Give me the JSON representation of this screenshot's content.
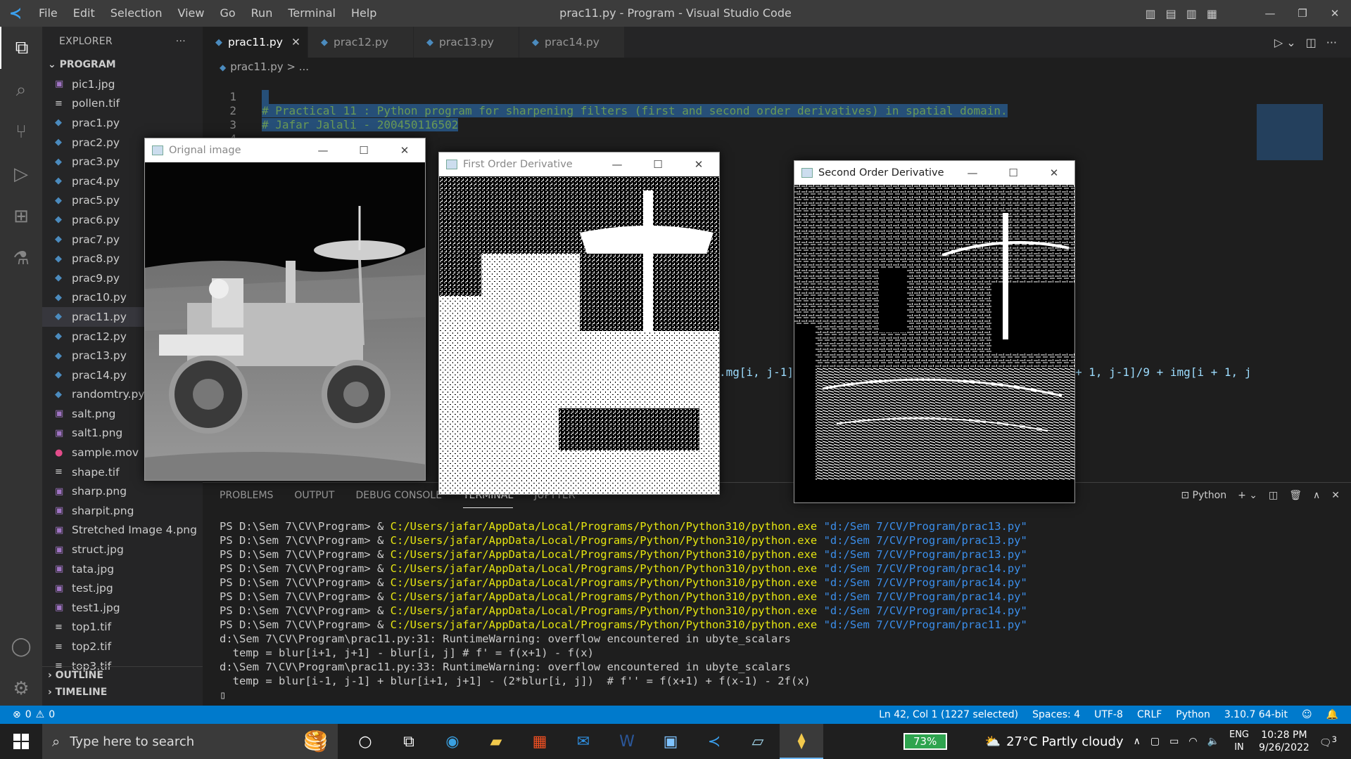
{
  "window": {
    "title": "prac11.py - Program - Visual Studio Code",
    "menu": [
      "File",
      "Edit",
      "Selection",
      "View",
      "Go",
      "Run",
      "Terminal",
      "Help"
    ]
  },
  "explorer": {
    "header": "EXPLORER",
    "more": "···",
    "section": "PROGRAM",
    "files": [
      {
        "name": "pic1.jpg",
        "icon": "image-icon"
      },
      {
        "name": "pollen.tif",
        "icon": "text-file-icon"
      },
      {
        "name": "prac1.py",
        "icon": "python-icon"
      },
      {
        "name": "prac2.py",
        "icon": "python-icon"
      },
      {
        "name": "prac3.py",
        "icon": "python-icon"
      },
      {
        "name": "prac4.py",
        "icon": "python-icon"
      },
      {
        "name": "prac5.py",
        "icon": "python-icon"
      },
      {
        "name": "prac6.py",
        "icon": "python-icon"
      },
      {
        "name": "prac7.py",
        "icon": "python-icon"
      },
      {
        "name": "prac8.py",
        "icon": "python-icon"
      },
      {
        "name": "prac9.py",
        "icon": "python-icon"
      },
      {
        "name": "prac10.py",
        "icon": "python-icon"
      },
      {
        "name": "prac11.py",
        "icon": "python-icon",
        "selected": true
      },
      {
        "name": "prac12.py",
        "icon": "python-icon"
      },
      {
        "name": "prac13.py",
        "icon": "python-icon"
      },
      {
        "name": "prac14.py",
        "icon": "python-icon"
      },
      {
        "name": "randomtry.py",
        "icon": "python-icon"
      },
      {
        "name": "salt.png",
        "icon": "image-icon"
      },
      {
        "name": "salt1.png",
        "icon": "image-icon"
      },
      {
        "name": "sample.mov",
        "icon": "video-icon"
      },
      {
        "name": "shape.tif",
        "icon": "text-file-icon"
      },
      {
        "name": "sharp.png",
        "icon": "image-icon"
      },
      {
        "name": "sharpit.png",
        "icon": "image-icon"
      },
      {
        "name": "Stretched Image 4.png",
        "icon": "image-icon"
      },
      {
        "name": "struct.jpg",
        "icon": "image-icon"
      },
      {
        "name": "tata.jpg",
        "icon": "image-icon"
      },
      {
        "name": "test.jpg",
        "icon": "image-icon"
      },
      {
        "name": "test1.jpg",
        "icon": "image-icon"
      },
      {
        "name": "top1.tif",
        "icon": "text-file-icon"
      },
      {
        "name": "top2.tif",
        "icon": "text-file-icon"
      },
      {
        "name": "top3.tif",
        "icon": "text-file-icon"
      }
    ],
    "outline": "OUTLINE",
    "timeline": "TIMELINE"
  },
  "tabs": [
    {
      "label": "prac11.py",
      "active": true
    },
    {
      "label": "prac12.py"
    },
    {
      "label": "prac13.py"
    },
    {
      "label": "prac14.py"
    }
  ],
  "breadcrumb": {
    "file": "prac11.py",
    "sep": " > ..."
  },
  "code": {
    "line_numbers": [
      "1",
      "2",
      "3",
      "4"
    ],
    "line2": "# Practical 11 : Python program for sharpening filters (first and second order derivatives) in spatial domain.",
    "line3": "# Jafar Jalali - 200450116502",
    "frag_right1": ".mg[i, j-1],",
    "frag_right2": "+ 1, j-1]/9 + img[i + 1, j"
  },
  "panel": {
    "tabs": [
      "PROBLEMS",
      "OUTPUT",
      "DEBUG CONSOLE",
      "TERMINAL",
      "JUPYTER"
    ],
    "active_tab": "TERMINAL",
    "shell": "Python",
    "terminal": {
      "prompt": "PS D:\\Sem 7\\CV\\Program> & ",
      "exe": "C:/Users/jafar/AppData/Local/Programs/Python/Python310/python.exe",
      "runs": [
        "\"d:/Sem 7/CV/Program/prac13.py\"",
        "\"d:/Sem 7/CV/Program/prac13.py\"",
        "\"d:/Sem 7/CV/Program/prac13.py\"",
        "\"d:/Sem 7/CV/Program/prac14.py\"",
        "\"d:/Sem 7/CV/Program/prac14.py\"",
        "\"d:/Sem 7/CV/Program/prac14.py\"",
        "\"d:/Sem 7/CV/Program/prac14.py\"",
        "\"d:/Sem 7/CV/Program/prac11.py\""
      ],
      "warn1": "d:\\Sem 7\\CV\\Program\\prac11.py:31: RuntimeWarning: overflow encountered in ubyte_scalars",
      "warn1b": "  temp = blur[i+1, j+1] - blur[i, j] # f' = f(x+1) - f(x)",
      "warn2": "d:\\Sem 7\\CV\\Program\\prac11.py:33: RuntimeWarning: overflow encountered in ubyte_scalars",
      "warn2b": "  temp = blur[i-1, j-1] + blur[i+1, j+1] - (2*blur[i, j])  # f'' = f(x+1) + f(x-1) - 2f(x)",
      "cursor": "▯"
    }
  },
  "statusbar": {
    "errors": "0",
    "warnings": "0",
    "position": "Ln 42, Col 1 (1227 selected)",
    "spaces": "Spaces: 4",
    "encoding": "UTF-8",
    "eol": "CRLF",
    "language": "Python",
    "interpreter": "3.10.7 64-bit"
  },
  "cv_windows": [
    {
      "title": "Orignal image",
      "active": false
    },
    {
      "title": "First Order Derivative",
      "active": false
    },
    {
      "title": "Second Order Derivative",
      "active": true
    }
  ],
  "taskbar": {
    "search_placeholder": "Type here to search",
    "battery": "73%",
    "weather": "27°C  Partly cloudy",
    "lang1": "ENG",
    "lang2": "IN",
    "time": "10:28 PM",
    "date": "9/26/2022",
    "notif_count": "3"
  }
}
